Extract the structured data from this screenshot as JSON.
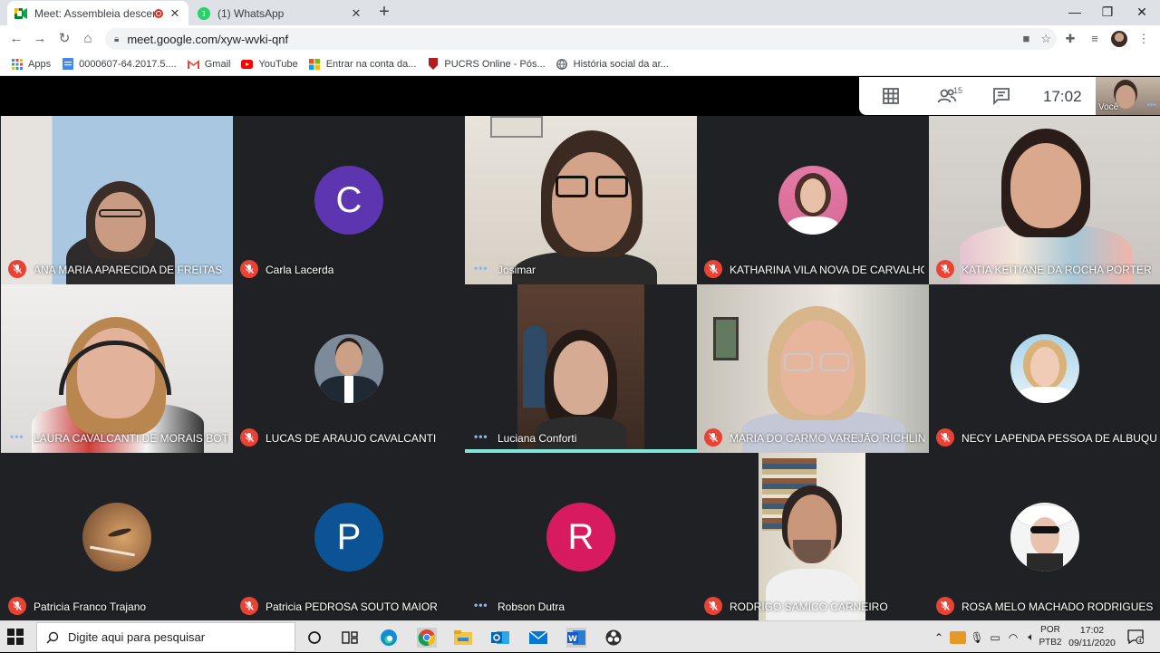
{
  "browser": {
    "tabs": [
      {
        "title": "Meet: Assembleia descentral",
        "active": true,
        "close": "✕"
      },
      {
        "title": "(1) WhatsApp",
        "active": false,
        "close": "✕"
      }
    ],
    "new_tab": "+",
    "window_controls": {
      "minimize": "—",
      "maximize": "❐",
      "close": "✕"
    },
    "url": "meet.google.com/xyw-wvki-qnf",
    "bookmarks": [
      {
        "label": "Apps",
        "icon": "apps-grid-icon"
      },
      {
        "label": "0000607-64.2017.5....",
        "icon": "docs-icon"
      },
      {
        "label": "Gmail",
        "icon": "gmail-icon"
      },
      {
        "label": "YouTube",
        "icon": "youtube-icon"
      },
      {
        "label": "Entrar na conta da...",
        "icon": "microsoft-icon"
      },
      {
        "label": "PUCRS Online - Pós...",
        "icon": "pucrs-icon"
      },
      {
        "label": "História social da ar...",
        "icon": "globe-icon"
      }
    ]
  },
  "meet": {
    "participant_count": "15",
    "time": "17:02",
    "self_label": "Você",
    "participants": [
      {
        "name": "ANA MARIA APARECIDA DE FREITAS",
        "muted": true
      },
      {
        "name": "Carla Lacerda",
        "muted": true,
        "initial": "C",
        "color": "#5e35b1"
      },
      {
        "name": "Josimar",
        "muted": false
      },
      {
        "name": "KATHARINA VILA NOVA DE CARVALHO...",
        "muted": true
      },
      {
        "name": "KATIA KEITIANE DA ROCHA PORTER",
        "muted": true
      },
      {
        "name": "LAURA CAVALCANTI DE MORAIS BOTE...",
        "muted": false
      },
      {
        "name": "LUCAS DE ARAUJO CAVALCANTI",
        "muted": true
      },
      {
        "name": "Luciana Conforti",
        "muted": false,
        "speaking": true
      },
      {
        "name": "MARIA DO CARMO VAREJÃO RICHLIN",
        "muted": true
      },
      {
        "name": "NECY LAPENDA PESSOA DE ALBUQUE...",
        "muted": true
      },
      {
        "name": "Patricia Franco Trajano",
        "muted": true
      },
      {
        "name": "Patricia PEDROSA SOUTO MAIOR",
        "muted": true,
        "initial": "P",
        "color": "#0b5394"
      },
      {
        "name": "Robson Dutra",
        "muted": false,
        "initial": "R",
        "color": "#d81b60"
      },
      {
        "name": "RODRIGO SAMICO CARNEIRO",
        "muted": true
      },
      {
        "name": "ROSA MELO MACHADO RODRIGUES FA...",
        "muted": true
      }
    ]
  },
  "taskbar": {
    "search_placeholder": "Digite aqui para pesquisar",
    "language": [
      "POR",
      "PTB2"
    ],
    "clock_time": "17:02",
    "clock_date": "09/11/2020",
    "notifications": "4"
  }
}
